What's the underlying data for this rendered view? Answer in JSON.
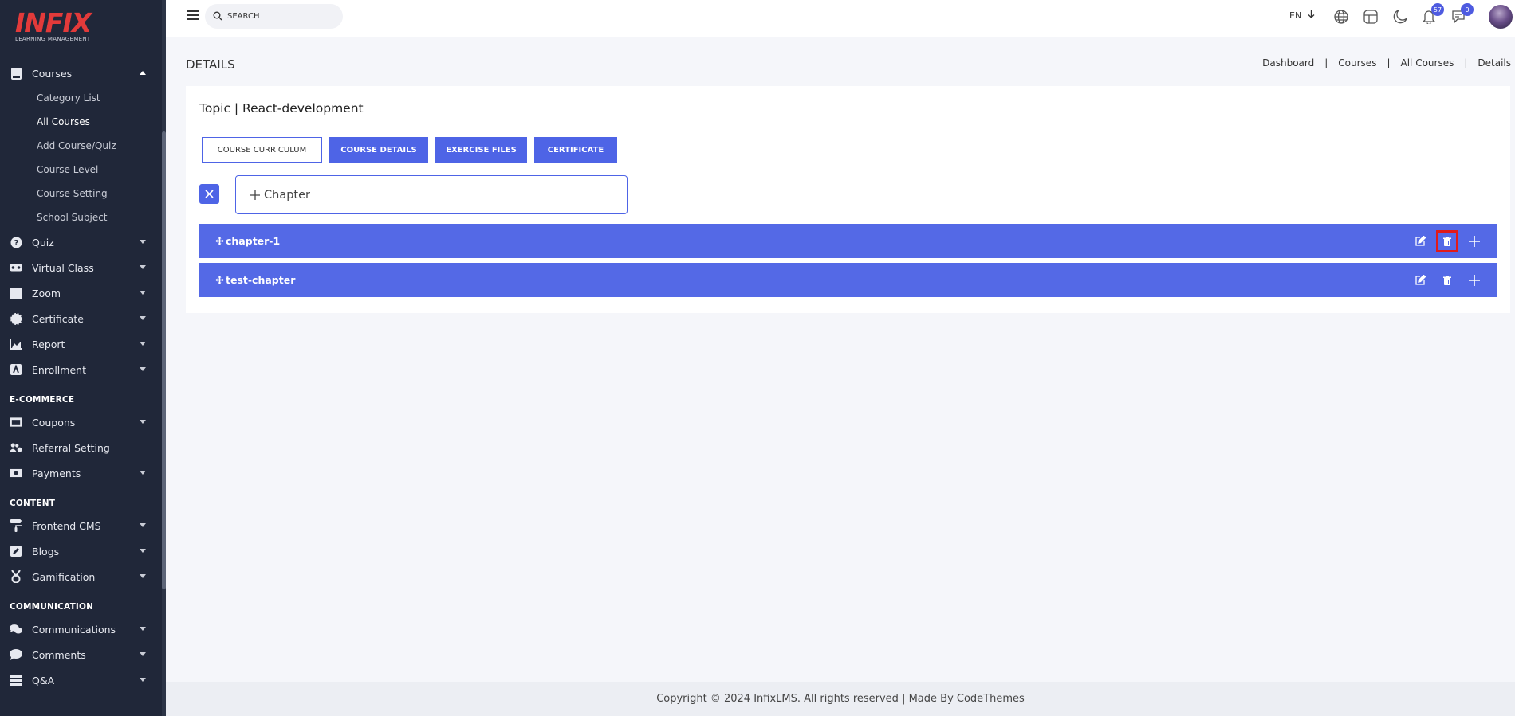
{
  "brand": {
    "name": "INFIX",
    "tagline": "LEARNING MANAGEMENT",
    "color": "#e23a3a"
  },
  "sidebar": {
    "courses": {
      "label": "Courses",
      "items": [
        "Category List",
        "All Courses",
        "Add Course/Quiz",
        "Course Level",
        "Course Setting",
        "School Subject"
      ],
      "active": "All Courses"
    },
    "main": [
      {
        "label": "Quiz",
        "icon": "question-circle-icon"
      },
      {
        "label": "Virtual Class",
        "icon": "vr-headset-icon"
      },
      {
        "label": "Zoom",
        "icon": "grid-icon"
      },
      {
        "label": "Certificate",
        "icon": "certificate-icon"
      },
      {
        "label": "Report",
        "icon": "chart-area-icon"
      },
      {
        "label": "Enrollment",
        "icon": "enrollment-icon"
      }
    ],
    "sections": {
      "ecommerce": "E-COMMERCE",
      "content": "CONTENT",
      "communication": "COMMUNICATION"
    },
    "ecommerce_items": [
      {
        "label": "Coupons",
        "icon": "ticket-icon",
        "caret": true
      },
      {
        "label": "Referral Setting",
        "icon": "users-cog-icon",
        "caret": false
      },
      {
        "label": "Payments",
        "icon": "money-bill-icon",
        "caret": true
      }
    ],
    "content_items": [
      {
        "label": "Frontend CMS",
        "icon": "paint-roller-icon"
      },
      {
        "label": "Blogs",
        "icon": "pen-square-icon"
      },
      {
        "label": "Gamification",
        "icon": "medal-icon"
      }
    ],
    "communication_items": [
      {
        "label": "Communications",
        "icon": "comments-icon"
      },
      {
        "label": "Comments",
        "icon": "comment-icon"
      },
      {
        "label": "Q&A",
        "icon": "grid-icon"
      }
    ]
  },
  "topbar": {
    "search_placeholder": "SEARCH",
    "language": "EN",
    "notifications_count": "57",
    "messages_count": "0"
  },
  "page": {
    "title": "DETAILS",
    "breadcrumb": [
      "Dashboard",
      "Courses",
      "All Courses",
      "Details"
    ]
  },
  "card": {
    "title": "Topic | React-development",
    "tabs": [
      "COURSE CURRICULUM",
      "COURSE DETAILS",
      "EXERCISE FILES",
      "CERTIFICATE"
    ],
    "chapter_input_label": "Chapter",
    "chapters": [
      "chapter-1",
      "test-chapter"
    ]
  },
  "footer": {
    "text": "Copyright © 2024 InfixLMS. All rights reserved | Made By CodeThemes"
  },
  "colors": {
    "sidebar_bg": "#202739",
    "primary": "#4e64e6",
    "highlight": "#e01a1a"
  }
}
